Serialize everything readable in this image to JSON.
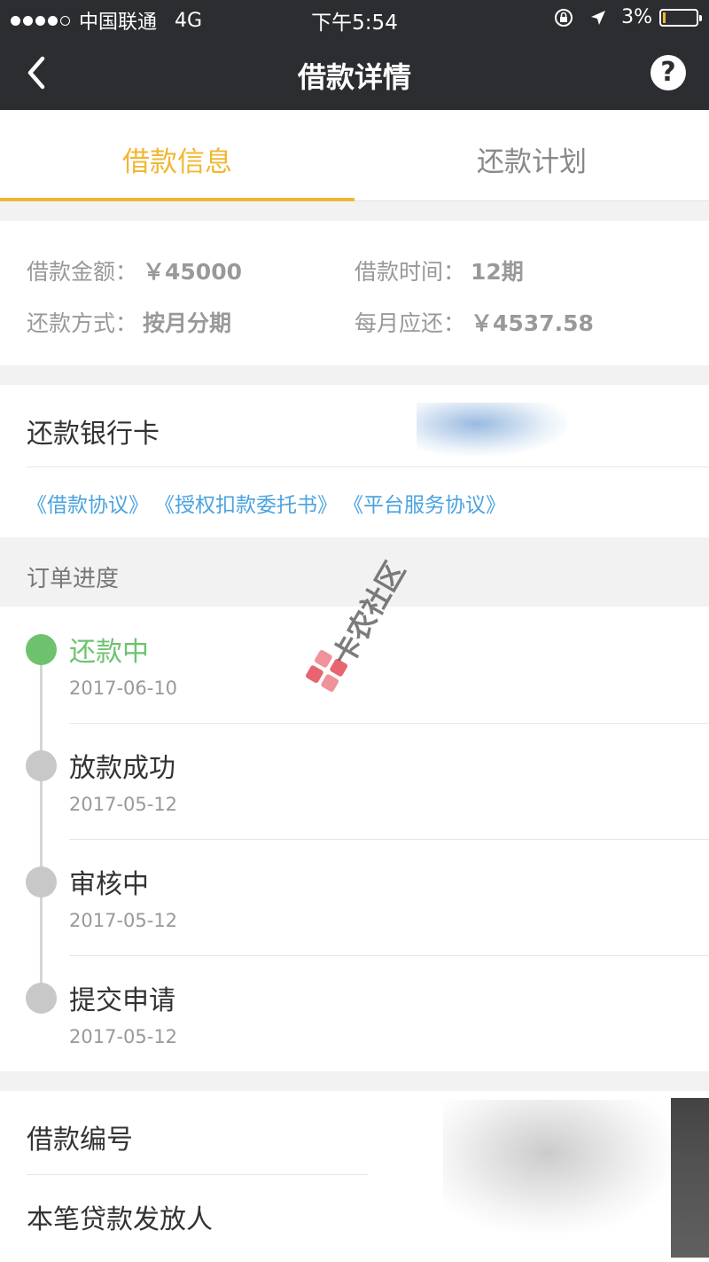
{
  "status_bar": {
    "carrier": "中国联通",
    "network": "4G",
    "time": "下午5:54",
    "battery": "3%",
    "battery_level": 0.03
  },
  "nav": {
    "title": "借款详情",
    "help": "?"
  },
  "tabs": [
    {
      "label": "借款信息",
      "active": true
    },
    {
      "label": "还款计划",
      "active": false
    }
  ],
  "loan_info": {
    "amount_label": "借款金额：",
    "amount_value": "￥45000",
    "term_label": "借款时间：",
    "term_value": "12期",
    "method_label": "还款方式：",
    "method_value": "按月分期",
    "monthly_label": "每月应还：",
    "monthly_value": "￥4537.58"
  },
  "bank": {
    "label": "还款银行卡",
    "links": [
      "《借款协议》",
      "《授权扣款委托书》",
      "《平台服务协议》"
    ]
  },
  "progress": {
    "header": "订单进度",
    "steps": [
      {
        "name": "还款中",
        "date": "2017-06-10",
        "active": true
      },
      {
        "name": "放款成功",
        "date": "2017-05-12",
        "active": false
      },
      {
        "name": "审核中",
        "date": "2017-05-12",
        "active": false
      },
      {
        "name": "提交申请",
        "date": "2017-05-12",
        "active": false
      }
    ]
  },
  "details": {
    "loan_number_label": "借款编号",
    "lender_label": "本笔贷款发放人"
  },
  "watermark": {
    "text": "卡农社区"
  },
  "colors": {
    "header_bg": "#2b2d30",
    "accent": "#f0b733",
    "active_step": "#6ec26e",
    "link": "#4aa3df"
  }
}
